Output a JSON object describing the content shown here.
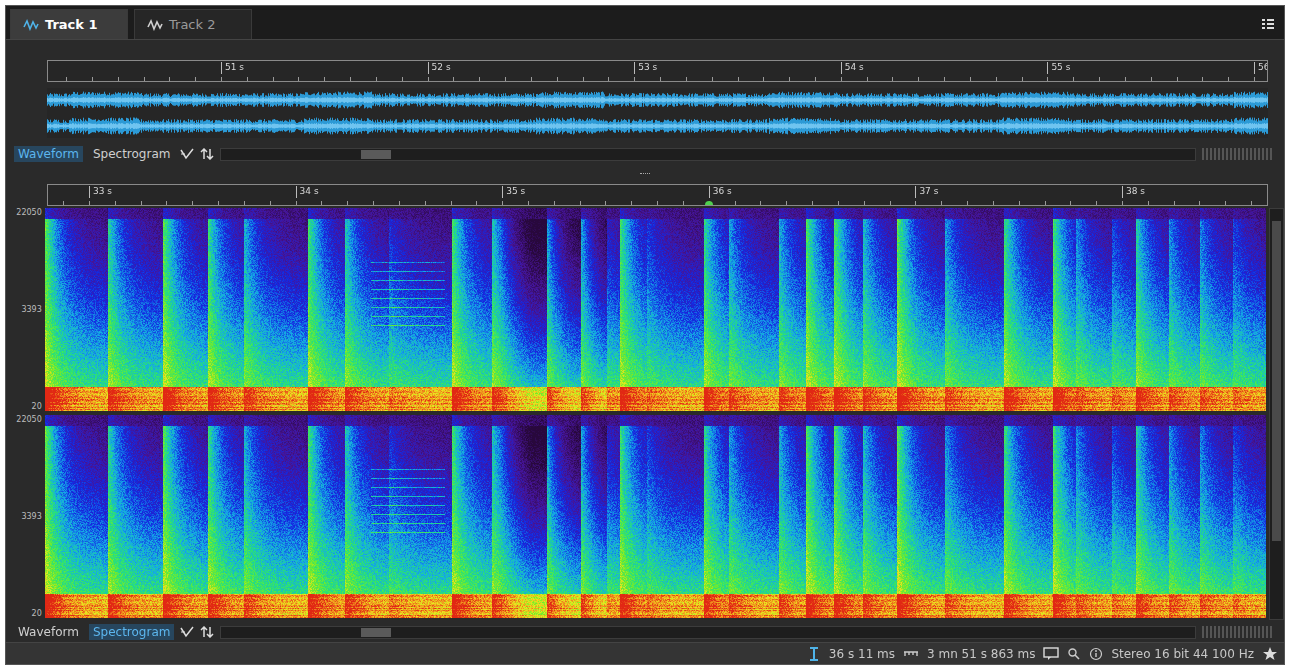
{
  "tabs": [
    {
      "label": "Track 1",
      "selected": true
    },
    {
      "label": "Track 2",
      "selected": false
    }
  ],
  "overview": {
    "ruler": [
      "51 s",
      "52 s",
      "53 s",
      "54 s",
      "55 s",
      "56"
    ],
    "views": [
      {
        "label": "Waveform",
        "selected": true
      },
      {
        "label": "Spectrogram",
        "selected": false
      }
    ]
  },
  "main": {
    "ruler": [
      "33 s",
      "34 s",
      "35 s",
      "36 s",
      "37 s",
      "38 s"
    ],
    "channels": [
      {
        "axis": [
          "22050",
          "3393",
          "20"
        ]
      },
      {
        "axis": [
          "22050",
          "3393",
          "20"
        ]
      }
    ],
    "views": [
      {
        "label": "Waveform",
        "selected": false
      },
      {
        "label": "Spectrogram",
        "selected": true
      }
    ]
  },
  "status_bar": {
    "cursor_time": "36 s 11 ms",
    "length": "3 mn 51 s 863 ms",
    "format": "Stereo 16 bit 44 100 Hz"
  }
}
